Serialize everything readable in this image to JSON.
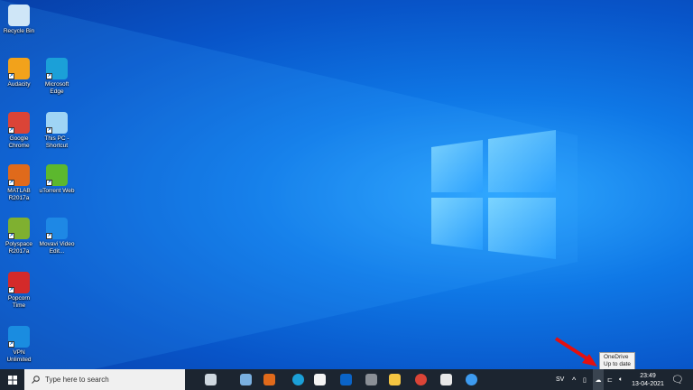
{
  "desktop": {
    "icons": [
      {
        "label": "Recycle Bin",
        "icon": "recycle-bin-icon",
        "color": "#cfe6f7"
      },
      {
        "label": "Audacity",
        "icon": "audacity-icon",
        "color": "#f2a21b"
      },
      {
        "label": "Microsoft Edge",
        "icon": "edge-icon",
        "color": "#1ba0d8"
      },
      {
        "label": "Google Chrome",
        "icon": "chrome-icon",
        "color": "#db4437"
      },
      {
        "label": "This PC - Shortcut",
        "icon": "computer-icon",
        "color": "#9fd4f5"
      },
      {
        "label": "MATLAB R2017a",
        "icon": "matlab-icon",
        "color": "#e06a1b"
      },
      {
        "label": "uTorrent Web",
        "icon": "utorrent-icon",
        "color": "#5cb82e"
      },
      {
        "label": "Polyspace R2017a",
        "icon": "polyspace-icon",
        "color": "#7fb030"
      },
      {
        "label": "Movavi Video Edit...",
        "icon": "movavi-icon",
        "color": "#1e88e5"
      },
      {
        "label": "Popcorn Time",
        "icon": "popcorn-icon",
        "color": "#d42a2a"
      },
      {
        "label": "VPN Unlimited",
        "icon": "vpn-icon",
        "color": "#1a8ce0"
      }
    ]
  },
  "taskbar": {
    "search_placeholder": "Type here to search",
    "apps": [
      {
        "name": "task-view",
        "color": "#cfd8e0"
      },
      {
        "name": "network-app",
        "color": "#7ab0e0"
      },
      {
        "name": "matlab",
        "color": "#e06a1b"
      },
      {
        "name": "edge",
        "color": "#1ba0d8"
      },
      {
        "name": "store",
        "color": "#f3f3f3"
      },
      {
        "name": "outlook",
        "color": "#0a64c8"
      },
      {
        "name": "settings-app",
        "color": "#8a8f96"
      },
      {
        "name": "file-explorer",
        "color": "#f4c542"
      },
      {
        "name": "chrome",
        "color": "#db4437"
      },
      {
        "name": "paint-app",
        "color": "#e8e8e8"
      },
      {
        "name": "vpn",
        "color": "#3d9bf0"
      }
    ]
  },
  "tray": {
    "lang": "SV",
    "time": "23:49",
    "date": "13-04-2021"
  },
  "tooltip": {
    "title": "OneDrive",
    "status": "Up to date"
  }
}
